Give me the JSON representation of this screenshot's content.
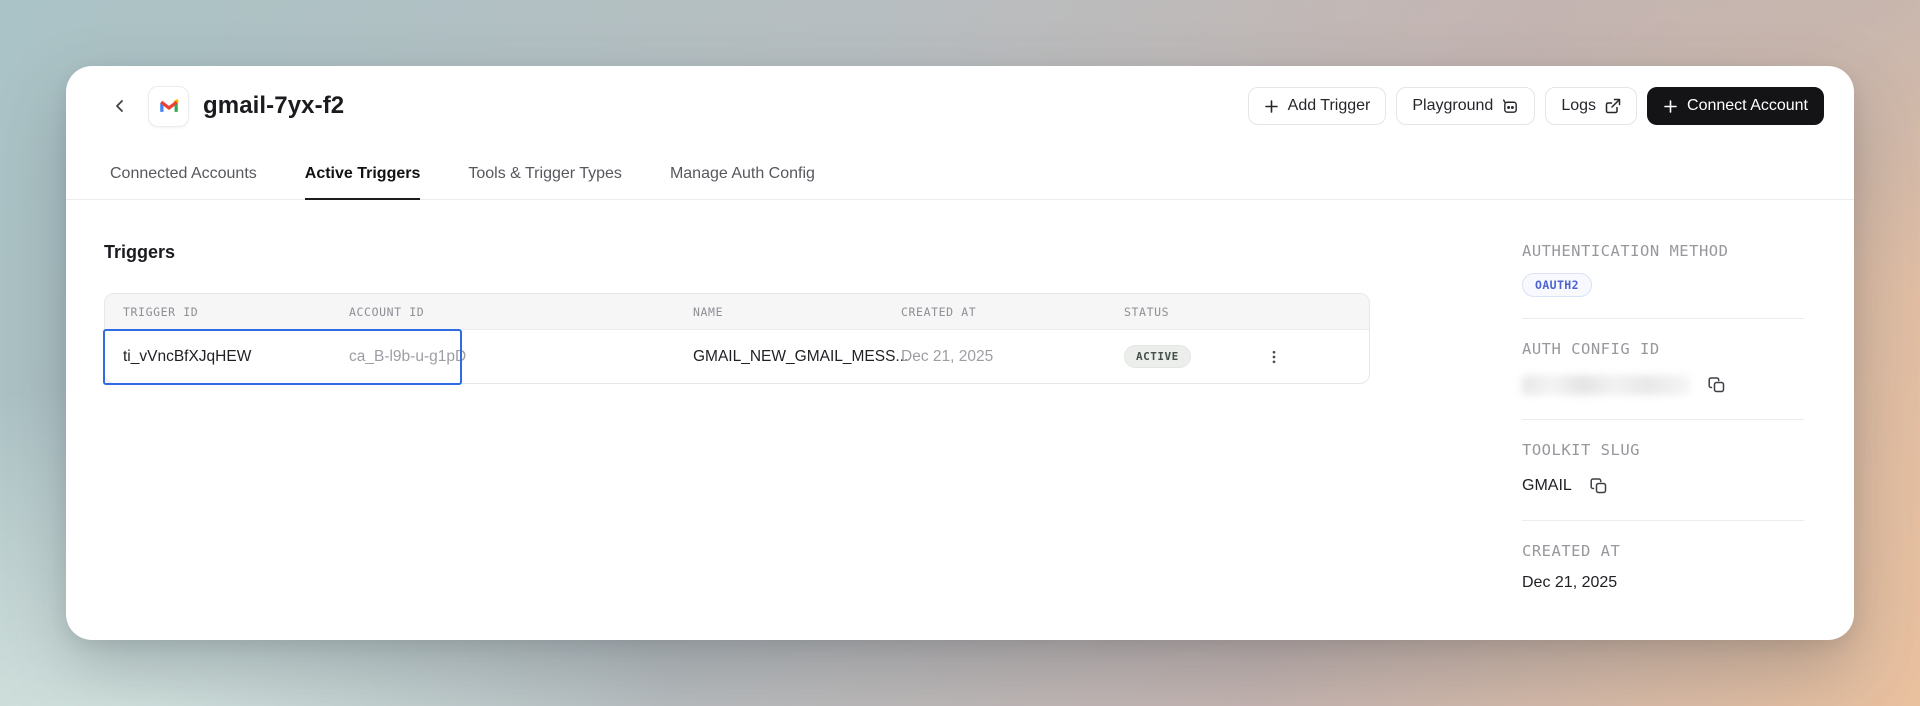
{
  "header": {
    "title": "gmail-7yx-f2",
    "actions": {
      "add_trigger": "Add Trigger",
      "playground": "Playground",
      "logs": "Logs",
      "connect_account": "Connect Account"
    }
  },
  "tabs": [
    {
      "label": "Connected Accounts",
      "active": false
    },
    {
      "label": "Active Triggers",
      "active": true
    },
    {
      "label": "Tools & Trigger Types",
      "active": false
    },
    {
      "label": "Manage Auth Config",
      "active": false
    }
  ],
  "main": {
    "section_title": "Triggers",
    "table": {
      "columns": [
        "TRIGGER ID",
        "ACCOUNT ID",
        "NAME",
        "CREATED AT",
        "STATUS"
      ],
      "rows": [
        {
          "trigger_id": "ti_vVncBfXJqHEW",
          "account_id": "ca_B-l9b-u-g1pD",
          "name": "GMAIL_NEW_GMAIL_MESS...",
          "created_at": "Dec 21, 2025",
          "status": "ACTIVE"
        }
      ]
    }
  },
  "sidebar": {
    "auth_method": {
      "label": "AUTHENTICATION METHOD",
      "badge": "OAUTH2"
    },
    "auth_config": {
      "label": "AUTH CONFIG ID",
      "value_redacted": true
    },
    "toolkit": {
      "label": "TOOLKIT SLUG",
      "value": "GMAIL"
    },
    "created": {
      "label": "CREATED AT",
      "value": "Dec 21, 2025"
    }
  },
  "icons": {
    "back": "chevron-left",
    "app": "gmail-logo",
    "add_trigger": "plus",
    "playground": "app-window",
    "logs": "external-link",
    "connect_account": "plus",
    "copy": "copy",
    "row_menu": "kebab-vertical"
  },
  "colors": {
    "highlight_border": "#2e6be5",
    "status_badge_bg": "#eceeec",
    "status_badge_text": "#44504a",
    "oauth_badge_text": "#4b63d2",
    "oauth_badge_bg": "#f7f9fe",
    "connect_button_bg": "#141417",
    "background_teal": "#aac3c6",
    "background_peach": "#eac19f"
  }
}
